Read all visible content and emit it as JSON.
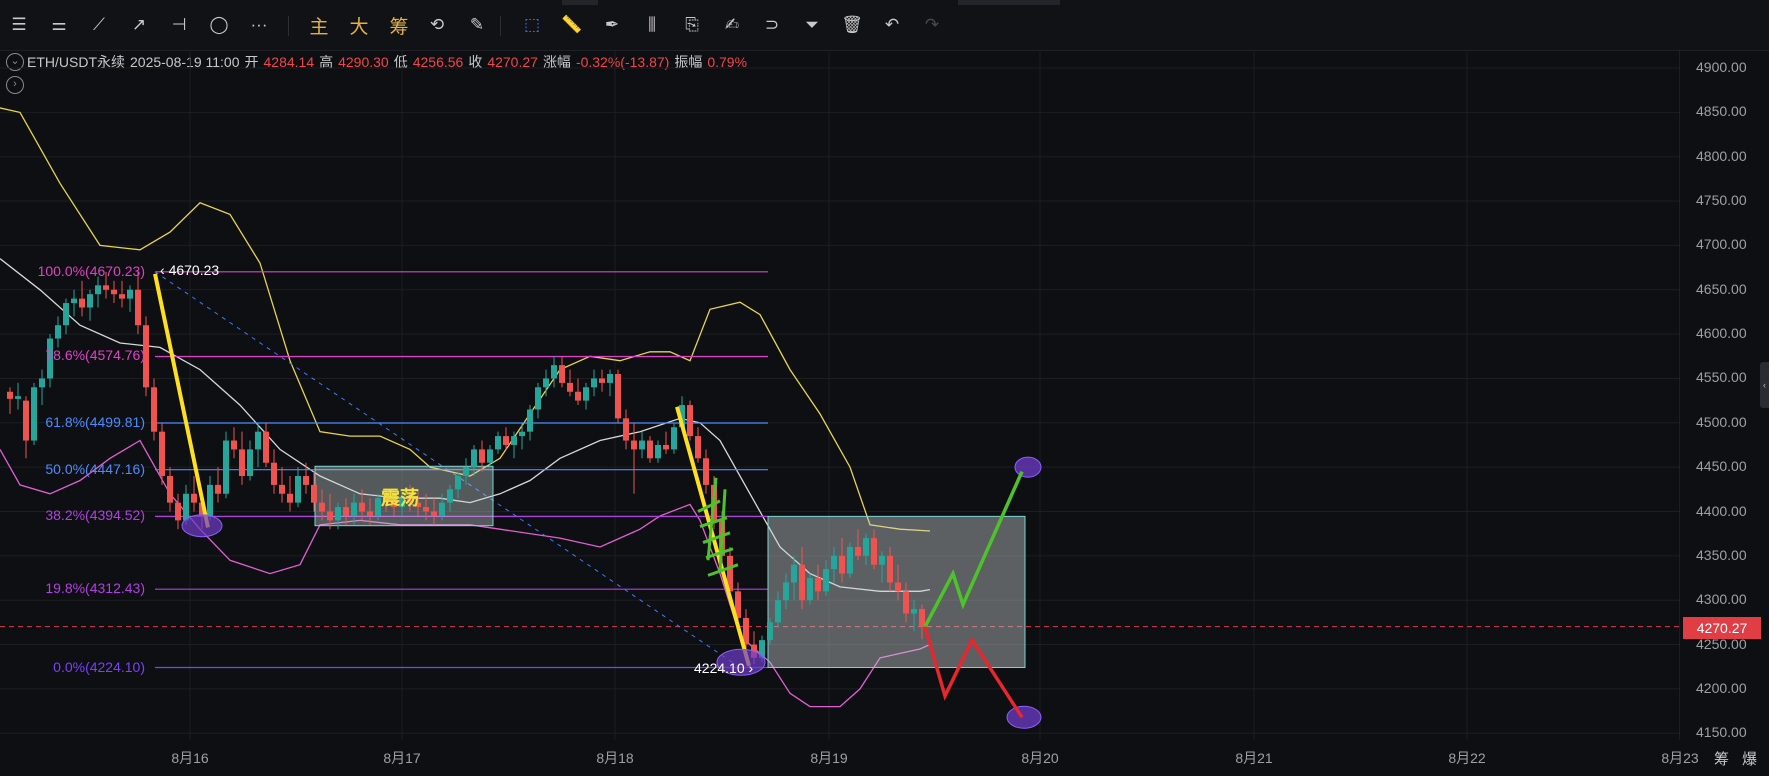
{
  "toolbar": {
    "items": [
      {
        "name": "menu-icon",
        "glyph": "☰"
      },
      {
        "name": "indicator-settings-icon",
        "glyph": "⚌"
      },
      {
        "name": "trend-line-icon",
        "glyph": "⟋"
      },
      {
        "name": "ray-line-icon",
        "glyph": "↗"
      },
      {
        "name": "horizontal-line-icon",
        "glyph": "⊣"
      },
      {
        "name": "ellipse-icon",
        "glyph": "◯"
      },
      {
        "name": "more-icon",
        "glyph": "···"
      }
    ],
    "cn_buttons": [
      "主",
      "大",
      "筹"
    ],
    "tools": [
      {
        "name": "replay-icon",
        "glyph": "⟲"
      },
      {
        "name": "draw-tools-icon",
        "glyph": "✎"
      },
      {
        "name": "cursor-icon",
        "glyph": "⬚"
      },
      {
        "name": "ruler-icon",
        "glyph": "📏"
      },
      {
        "name": "pen-icon",
        "glyph": "✒"
      },
      {
        "name": "candle-type-icon",
        "glyph": "⫼"
      },
      {
        "name": "clipboard-icon",
        "glyph": "⎘"
      },
      {
        "name": "note-icon",
        "glyph": "✍"
      },
      {
        "name": "magnet-icon",
        "glyph": "⊃"
      },
      {
        "name": "filter-icon",
        "glyph": "⏷"
      },
      {
        "name": "delete-icon",
        "glyph": "🗑"
      },
      {
        "name": "undo-icon",
        "glyph": "↶"
      },
      {
        "name": "redo-icon",
        "glyph": "↷"
      }
    ]
  },
  "ohlc": {
    "symbol": "ETH/USDT永续",
    "datetime": "2025-08-19 11:00",
    "open_label": "开",
    "open": "4284.14",
    "high_label": "高",
    "high": "4290.30",
    "low_label": "低",
    "low": "4256.56",
    "close_label": "收",
    "close": "4270.27",
    "change_label": "涨幅",
    "change": "-0.32%(-13.87)",
    "amp_label": "振幅",
    "amp": "0.79%"
  },
  "price_axis": {
    "ticks": [
      "4900.00",
      "4850.00",
      "4800.00",
      "4750.00",
      "4700.00",
      "4650.00",
      "4600.00",
      "4550.00",
      "4500.00",
      "4450.00",
      "4400.00",
      "4350.00",
      "4300.00",
      "4250.00",
      "4200.00",
      "4150.00"
    ],
    "current_price": "4270.27"
  },
  "time_axis": {
    "ticks": [
      "8月16",
      "8月17",
      "8月18",
      "8月19",
      "8月20",
      "8月21",
      "8月22",
      "8月23"
    ],
    "btn_chip": "筹",
    "btn_burst": "爆"
  },
  "fib_levels": [
    {
      "label": "100.0%(4670.23)",
      "price": 4670.23,
      "color": "#e040c8"
    },
    {
      "label": "78.6%(4574.76)",
      "price": 4574.76,
      "color": "#e040c8"
    },
    {
      "label": "61.8%(4499.81)",
      "price": 4499.81,
      "color": "#4a8cff"
    },
    {
      "label": "50.0%(4447.16)",
      "price": 4447.16,
      "color": "#4a8cff"
    },
    {
      "label": "38.2%(4394.52)",
      "price": 4394.52,
      "color": "#b040e0"
    },
    {
      "label": "19.8%(4312.43)",
      "price": 4312.43,
      "color": "#b040e0"
    },
    {
      "label": "0.0%(4224.10)",
      "price": 4224.1,
      "color": "#7a40ff"
    }
  ],
  "annotations": {
    "high_point": "4670.23",
    "low_point": "4224.10",
    "consolidation": "震荡"
  },
  "colors": {
    "up": "#26a69a",
    "down": "#ef5350",
    "boll_upper": "#e8d44a",
    "boll_lower": "#e060d0",
    "boll_mid": "#d8d8d8",
    "scenario_up": "#4ec22a",
    "scenario_down": "#e8262e"
  },
  "chart_data": {
    "type": "candlestick",
    "symbol": "ETH/USDT永续",
    "y_range": [
      4130,
      4920
    ],
    "series": [
      {
        "name": "upper_band",
        "points": [
          [
            0,
            4855
          ],
          [
            20,
            4850
          ],
          [
            60,
            4770
          ],
          [
            100,
            4700
          ],
          [
            140,
            4695
          ],
          [
            170,
            4715
          ],
          [
            200,
            4748
          ],
          [
            230,
            4735
          ],
          [
            260,
            4680
          ],
          [
            290,
            4570
          ],
          [
            320,
            4490
          ],
          [
            350,
            4485
          ],
          [
            380,
            4485
          ],
          [
            410,
            4470
          ],
          [
            430,
            4450
          ],
          [
            470,
            4440
          ],
          [
            500,
            4460
          ],
          [
            530,
            4510
          ],
          [
            560,
            4560
          ],
          [
            590,
            4575
          ],
          [
            620,
            4570
          ],
          [
            650,
            4580
          ],
          [
            670,
            4580
          ],
          [
            690,
            4570
          ],
          [
            710,
            4628
          ],
          [
            740,
            4636
          ],
          [
            760,
            4622
          ],
          [
            790,
            4560
          ],
          [
            820,
            4510
          ],
          [
            850,
            4450
          ],
          [
            870,
            4385
          ],
          [
            900,
            4380
          ],
          [
            930,
            4378
          ]
        ]
      },
      {
        "name": "lower_band",
        "points": [
          [
            0,
            4470
          ],
          [
            20,
            4430
          ],
          [
            50,
            4420
          ],
          [
            80,
            4435
          ],
          [
            110,
            4460
          ],
          [
            140,
            4480
          ],
          [
            170,
            4420
          ],
          [
            200,
            4380
          ],
          [
            230,
            4345
          ],
          [
            270,
            4330
          ],
          [
            300,
            4340
          ],
          [
            320,
            4385
          ],
          [
            360,
            4390
          ],
          [
            400,
            4385
          ],
          [
            440,
            4385
          ],
          [
            470,
            4385
          ],
          [
            500,
            4380
          ],
          [
            560,
            4370
          ],
          [
            600,
            4360
          ],
          [
            640,
            4380
          ],
          [
            660,
            4395
          ],
          [
            690,
            4408
          ],
          [
            700,
            4390
          ],
          [
            720,
            4330
          ],
          [
            740,
            4260
          ],
          [
            770,
            4230
          ],
          [
            790,
            4195
          ],
          [
            810,
            4180
          ],
          [
            840,
            4180
          ],
          [
            860,
            4200
          ],
          [
            880,
            4235
          ],
          [
            900,
            4240
          ],
          [
            920,
            4245
          ],
          [
            930,
            4250
          ]
        ]
      },
      {
        "name": "middle_band",
        "points": [
          [
            0,
            4685
          ],
          [
            40,
            4650
          ],
          [
            80,
            4610
          ],
          [
            120,
            4590
          ],
          [
            160,
            4585
          ],
          [
            200,
            4560
          ],
          [
            240,
            4520
          ],
          [
            280,
            4470
          ],
          [
            320,
            4440
          ],
          [
            360,
            4420
          ],
          [
            400,
            4415
          ],
          [
            440,
            4415
          ],
          [
            470,
            4410
          ],
          [
            500,
            4420
          ],
          [
            530,
            4435
          ],
          [
            560,
            4460
          ],
          [
            600,
            4480
          ],
          [
            640,
            4490
          ],
          [
            680,
            4505
          ],
          [
            700,
            4500
          ],
          [
            720,
            4480
          ],
          [
            750,
            4420
          ],
          [
            780,
            4360
          ],
          [
            810,
            4330
          ],
          [
            840,
            4315
          ],
          [
            880,
            4310
          ],
          [
            920,
            4310
          ],
          [
            930,
            4312
          ]
        ]
      }
    ],
    "candles": [
      [
        10,
        4535,
        4540,
        4510,
        4527
      ],
      [
        18,
        4527,
        4545,
        4515,
        4530
      ],
      [
        26,
        4525,
        4530,
        4460,
        4480
      ],
      [
        34,
        4480,
        4545,
        4475,
        4540
      ],
      [
        42,
        4540,
        4560,
        4520,
        4550
      ],
      [
        50,
        4550,
        4600,
        4540,
        4595
      ],
      [
        58,
        4595,
        4620,
        4585,
        4610
      ],
      [
        66,
        4610,
        4640,
        4600,
        4635
      ],
      [
        74,
        4635,
        4650,
        4620,
        4640
      ],
      [
        82,
        4640,
        4660,
        4620,
        4630
      ],
      [
        90,
        4630,
        4650,
        4615,
        4645
      ],
      [
        98,
        4645,
        4665,
        4630,
        4655
      ],
      [
        106,
        4655,
        4670,
        4640,
        4650
      ],
      [
        114,
        4650,
        4660,
        4635,
        4645
      ],
      [
        122,
        4645,
        4660,
        4630,
        4640
      ],
      [
        130,
        4640,
        4655,
        4625,
        4650
      ],
      [
        138,
        4650,
        4670,
        4600,
        4610
      ],
      [
        146,
        4610,
        4620,
        4530,
        4540
      ],
      [
        154,
        4540,
        4550,
        4480,
        4490
      ],
      [
        162,
        4490,
        4500,
        4430,
        4440
      ],
      [
        170,
        4440,
        4450,
        4400,
        4410
      ],
      [
        178,
        4410,
        4420,
        4380,
        4390
      ],
      [
        186,
        4390,
        4430,
        4385,
        4420
      ],
      [
        194,
        4420,
        4440,
        4400,
        4410
      ],
      [
        202,
        4410,
        4420,
        4380,
        4395
      ],
      [
        210,
        4395,
        4440,
        4390,
        4430
      ],
      [
        218,
        4430,
        4450,
        4410,
        4420
      ],
      [
        226,
        4420,
        4490,
        4415,
        4480
      ],
      [
        234,
        4480,
        4495,
        4460,
        4470
      ],
      [
        242,
        4470,
        4490,
        4430,
        4440
      ],
      [
        250,
        4440,
        4480,
        4435,
        4470
      ],
      [
        258,
        4470,
        4500,
        4450,
        4490
      ],
      [
        266,
        4490,
        4500,
        4450,
        4455
      ],
      [
        274,
        4455,
        4470,
        4420,
        4430
      ],
      [
        282,
        4430,
        4450,
        4410,
        4420
      ],
      [
        290,
        4420,
        4440,
        4400,
        4410
      ],
      [
        298,
        4410,
        4450,
        4405,
        4440
      ],
      [
        306,
        4440,
        4455,
        4420,
        4430
      ],
      [
        314,
        4430,
        4445,
        4400,
        4410
      ],
      [
        322,
        4410,
        4425,
        4390,
        4400
      ],
      [
        330,
        4400,
        4420,
        4380,
        4390
      ],
      [
        338,
        4390,
        4410,
        4380,
        4405
      ],
      [
        346,
        4405,
        4415,
        4385,
        4395
      ],
      [
        354,
        4395,
        4420,
        4385,
        4410
      ],
      [
        362,
        4410,
        4425,
        4390,
        4400
      ],
      [
        370,
        4400,
        4415,
        4385,
        4395
      ],
      [
        378,
        4395,
        4420,
        4390,
        4415
      ],
      [
        386,
        4415,
        4425,
        4400,
        4410
      ],
      [
        394,
        4410,
        4420,
        4395,
        4405
      ],
      [
        402,
        4405,
        4420,
        4395,
        4415
      ],
      [
        410,
        4415,
        4430,
        4400,
        4410
      ],
      [
        418,
        4410,
        4425,
        4395,
        4405
      ],
      [
        426,
        4405,
        4420,
        4390,
        4400
      ],
      [
        434,
        4400,
        4415,
        4385,
        4395
      ],
      [
        442,
        4395,
        4420,
        4390,
        4410
      ],
      [
        450,
        4410,
        4430,
        4400,
        4425
      ],
      [
        458,
        4425,
        4445,
        4415,
        4440
      ],
      [
        466,
        4440,
        4460,
        4430,
        4450
      ],
      [
        474,
        4450,
        4475,
        4440,
        4470
      ],
      [
        482,
        4470,
        4480,
        4445,
        4455
      ],
      [
        490,
        4455,
        4475,
        4450,
        4470
      ],
      [
        498,
        4470,
        4490,
        4465,
        4485
      ],
      [
        506,
        4485,
        4495,
        4470,
        4475
      ],
      [
        514,
        4475,
        4490,
        4460,
        4485
      ],
      [
        522,
        4485,
        4500,
        4470,
        4490
      ],
      [
        530,
        4490,
        4520,
        4480,
        4515
      ],
      [
        538,
        4515,
        4545,
        4505,
        4540
      ],
      [
        546,
        4540,
        4560,
        4530,
        4550
      ],
      [
        554,
        4550,
        4575,
        4540,
        4565
      ],
      [
        562,
        4565,
        4575,
        4540,
        4545
      ],
      [
        570,
        4545,
        4560,
        4530,
        4535
      ],
      [
        578,
        4535,
        4550,
        4520,
        4525
      ],
      [
        586,
        4525,
        4545,
        4515,
        4540
      ],
      [
        594,
        4540,
        4560,
        4530,
        4550
      ],
      [
        602,
        4550,
        4560,
        4535,
        4545
      ],
      [
        610,
        4545,
        4560,
        4530,
        4555
      ],
      [
        618,
        4555,
        4560,
        4500,
        4505
      ],
      [
        626,
        4505,
        4515,
        4470,
        4480
      ],
      [
        634,
        4480,
        4500,
        4420,
        4470
      ],
      [
        642,
        4470,
        4490,
        4460,
        4480
      ],
      [
        650,
        4480,
        4485,
        4455,
        4460
      ],
      [
        658,
        4460,
        4480,
        4455,
        4475
      ],
      [
        666,
        4475,
        4490,
        4465,
        4470
      ],
      [
        674,
        4470,
        4500,
        4465,
        4495
      ],
      [
        682,
        4495,
        4530,
        4490,
        4520
      ],
      [
        690,
        4520,
        4525,
        4480,
        4485
      ],
      [
        698,
        4485,
        4495,
        4455,
        4460
      ],
      [
        706,
        4460,
        4470,
        4420,
        4430
      ],
      [
        714,
        4430,
        4440,
        4380,
        4390
      ],
      [
        722,
        4390,
        4400,
        4340,
        4350
      ],
      [
        730,
        4350,
        4360,
        4300,
        4310
      ],
      [
        738,
        4310,
        4320,
        4270,
        4280
      ],
      [
        746,
        4280,
        4290,
        4240,
        4250
      ],
      [
        754,
        4250,
        4265,
        4228,
        4235
      ],
      [
        762,
        4235,
        4260,
        4230,
        4255
      ],
      [
        770,
        4255,
        4280,
        4250,
        4275
      ],
      [
        778,
        4275,
        4310,
        4270,
        4300
      ],
      [
        786,
        4300,
        4330,
        4290,
        4320
      ],
      [
        794,
        4320,
        4350,
        4300,
        4340
      ],
      [
        802,
        4340,
        4360,
        4290,
        4300
      ],
      [
        810,
        4300,
        4330,
        4295,
        4325
      ],
      [
        818,
        4325,
        4340,
        4300,
        4310
      ],
      [
        826,
        4310,
        4345,
        4305,
        4335
      ],
      [
        834,
        4335,
        4360,
        4320,
        4350
      ],
      [
        842,
        4350,
        4370,
        4320,
        4330
      ],
      [
        850,
        4330,
        4365,
        4325,
        4360
      ],
      [
        858,
        4360,
        4380,
        4345,
        4350
      ],
      [
        866,
        4350,
        4375,
        4340,
        4370
      ],
      [
        874,
        4370,
        4380,
        4335,
        4340
      ],
      [
        882,
        4340,
        4355,
        4320,
        4350
      ],
      [
        890,
        4350,
        4360,
        4310,
        4320
      ],
      [
        898,
        4320,
        4340,
        4300,
        4310
      ],
      [
        906,
        4310,
        4320,
        4275,
        4285
      ],
      [
        914,
        4285,
        4300,
        4265,
        4290
      ],
      [
        922,
        4290,
        4295,
        4256,
        4270
      ]
    ],
    "scenarios": {
      "bullish": [
        [
          925,
          4270
        ],
        [
          953,
          4330
        ],
        [
          963,
          4295
        ],
        [
          1022,
          4445
        ]
      ],
      "bearish": [
        [
          925,
          4270
        ],
        [
          945,
          4192
        ],
        [
          972,
          4255
        ],
        [
          1022,
          4168
        ]
      ]
    }
  }
}
